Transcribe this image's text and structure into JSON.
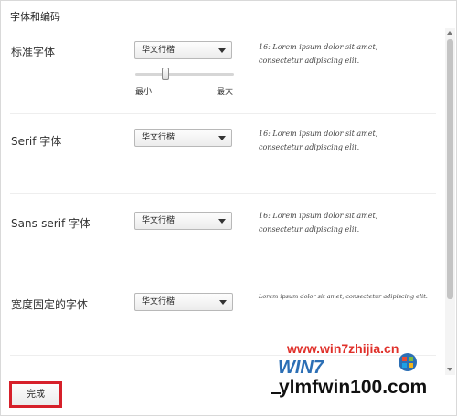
{
  "dialog": {
    "title": "字体和编码",
    "done_label": "完成"
  },
  "sample_text": "16: Lorem ipsum dolor sit amet, consectetur adipiscing elit.",
  "sample_text_fixed": "Lorem ipsum dolor sit amet, consectetur adipiscing elit.",
  "rows": [
    {
      "label": "标准字体",
      "value": "华文行楷"
    },
    {
      "label": "Serif 字体",
      "value": "华文行楷"
    },
    {
      "label": "Sans-serif 字体",
      "value": "华文行楷"
    },
    {
      "label": "宽度固定的字体",
      "value": "华文行楷"
    }
  ],
  "font_size_slider": {
    "min_label": "最小",
    "max_label": "最大",
    "value_fraction": 0.3
  },
  "watermark": {
    "top": "www.win7zhijia.cn",
    "brand": "WIN7",
    "bottom": "ylmfwin100.com"
  }
}
